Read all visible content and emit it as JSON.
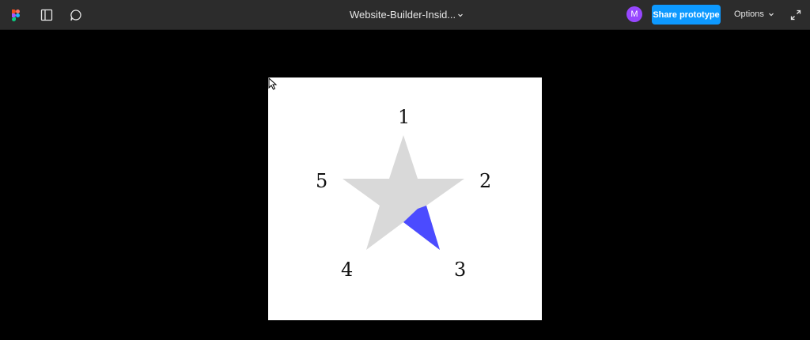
{
  "topbar": {
    "file_name": "Website-Builder-Insid...",
    "avatar_initial": "M",
    "share_label": "Share prototype",
    "options_label": "Options",
    "icons": [
      "figma-logo-icon",
      "sidebar-toggle-icon",
      "comment-icon",
      "chevron-down-icon",
      "expand-icon"
    ]
  },
  "prototype": {
    "star_numbers": [
      "1",
      "2",
      "3",
      "4",
      "5"
    ],
    "star_color": "#d9d9d9",
    "highlight_color": "#4b4bff",
    "highlighted_point": "3"
  },
  "colors": {
    "topbar_bg": "#2c2c2c",
    "accent": "#0d99ff",
    "avatar": "#9747ff",
    "canvas_bg": "#000000"
  }
}
